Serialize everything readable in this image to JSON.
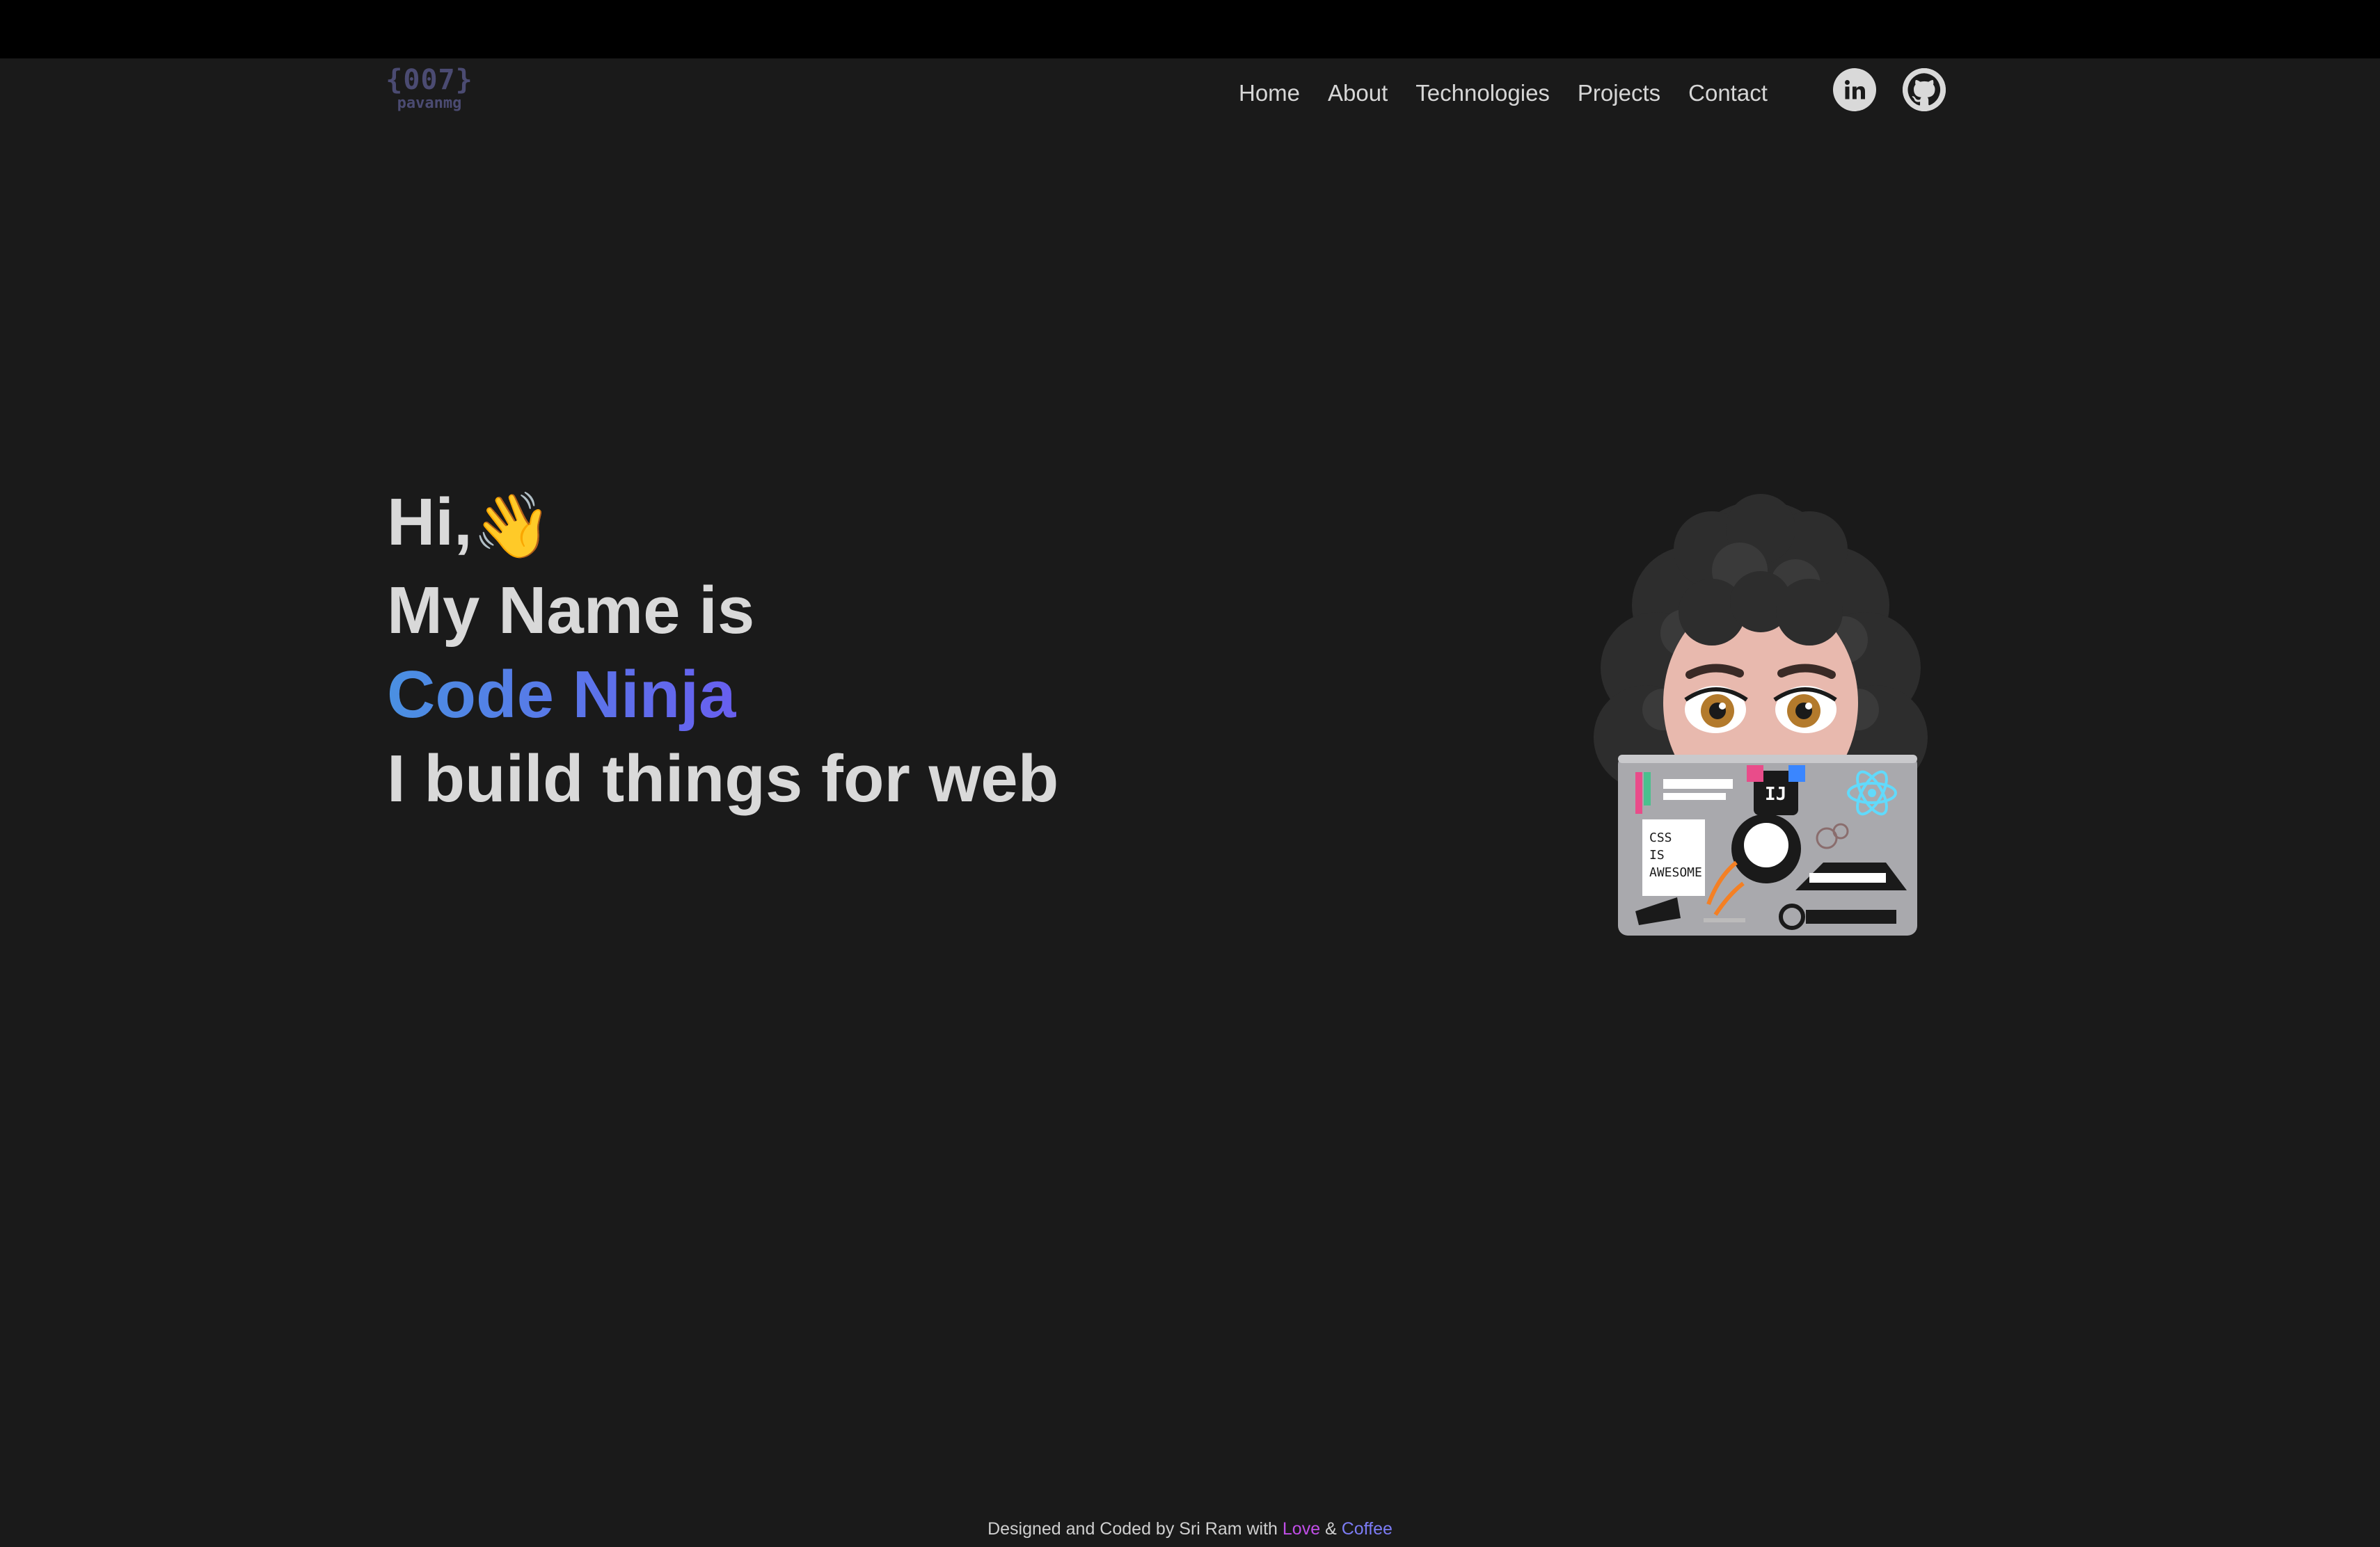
{
  "logo": {
    "main": "{007}",
    "sub": "pavanmg"
  },
  "nav": {
    "items": [
      "Home",
      "About",
      "Technologies",
      "Projects",
      "Contact"
    ]
  },
  "socials": {
    "linkedin_icon": "linkedin-icon",
    "github_icon": "github-icon"
  },
  "hero": {
    "greeting": "Hi,",
    "wave_emoji": "👋",
    "line2": "My Name is",
    "line3": "Code Ninja",
    "line4": "I build things for web"
  },
  "footer": {
    "prefix": "Designed and Coded by Sri Ram with ",
    "love": "Love",
    "amp": " & ",
    "coffee": "Coffee"
  },
  "colors": {
    "background": "#1a1a1a",
    "topbar": "#000000",
    "text": "#d9d9d9",
    "gradient_start": "#4a90e2",
    "gradient_end": "#b14ee8",
    "logo": "#4b4b72"
  }
}
